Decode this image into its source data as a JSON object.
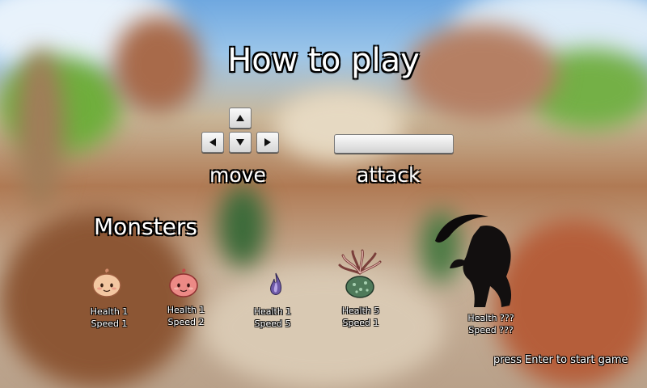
{
  "title": "How to play",
  "controls": {
    "move_label": "move",
    "attack_label": "attack",
    "keys": [
      "up-arrow-icon",
      "left-arrow-icon",
      "down-arrow-icon",
      "right-arrow-icon",
      "spacebar-icon"
    ]
  },
  "monsters_heading": "Monsters",
  "monsters": [
    {
      "icon": "peach-slime-icon",
      "health": "Health 1",
      "speed": "Speed 1"
    },
    {
      "icon": "pink-slime-icon",
      "health": "Health 1",
      "speed": "Speed 2"
    },
    {
      "icon": "purple-wisp-icon",
      "health": "Health 1",
      "speed": "Speed 5"
    },
    {
      "icon": "tentacle-plant-icon",
      "health": "Health 5",
      "speed": "Speed 1"
    },
    {
      "icon": "shadow-boss-icon",
      "health": "Health ???",
      "speed": "Speed ???"
    }
  ],
  "start_hint": "press Enter to start game",
  "colors": {
    "text": "#ffffff",
    "outline": "#000000"
  }
}
